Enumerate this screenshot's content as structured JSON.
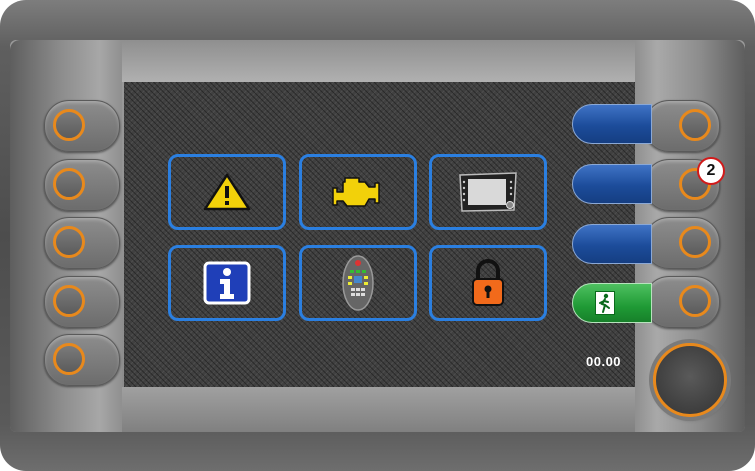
{
  "clock": {
    "value": "00.00"
  },
  "callout": {
    "label": "2"
  },
  "left_buttons": [
    "left-hw-button-1",
    "left-hw-button-2",
    "left-hw-button-3",
    "left-hw-button-4",
    "left-hw-button-5"
  ],
  "right_buttons": [
    "right-hw-button-1",
    "right-hw-button-2",
    "right-hw-button-3",
    "right-hw-button-4"
  ],
  "softkeys": [
    {
      "name": "softkey-1",
      "label": ""
    },
    {
      "name": "softkey-2",
      "label": ""
    },
    {
      "name": "softkey-3",
      "label": ""
    },
    {
      "name": "softkey-exit",
      "icon": "exit-icon"
    }
  ],
  "menu_tiles": [
    {
      "icon": "warning-icon"
    },
    {
      "icon": "engine-icon"
    },
    {
      "icon": "display-settings-icon"
    },
    {
      "icon": "info-icon"
    },
    {
      "icon": "keypad-icon"
    },
    {
      "icon": "lock-icon"
    }
  ],
  "colors": {
    "accent_orange": "#e8891c",
    "tile_border": "#2b7fe0",
    "softkey_blue": "#1c4c9a",
    "softkey_green": "#1f9a35",
    "callout_red": "#d11a1a"
  }
}
